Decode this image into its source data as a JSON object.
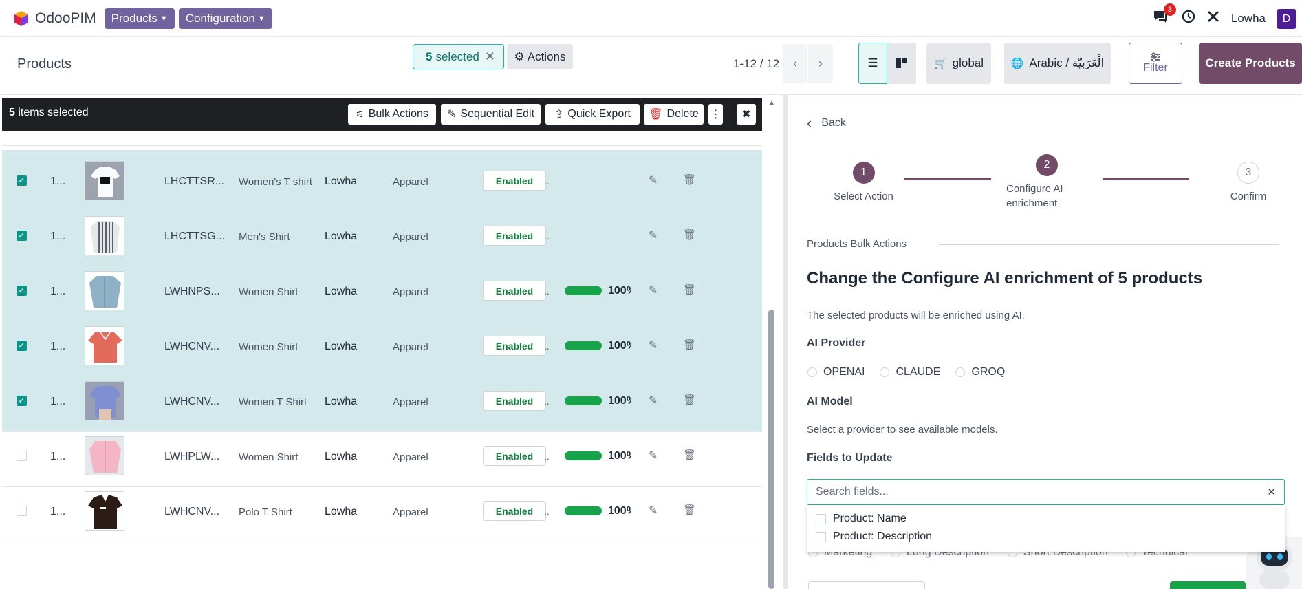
{
  "topbar": {
    "app_name": "OdooPIM",
    "menus": [
      {
        "label": "Products"
      },
      {
        "label": "Configuration"
      }
    ],
    "chat_badge": "3",
    "user_name": "Lowha",
    "avatar_letter": "D"
  },
  "control_panel": {
    "title": "Products",
    "selected_count": "5",
    "selected_label": "selected",
    "actions_label": "Actions",
    "pager": "1-12 / 12",
    "scope_label": "global",
    "language_label": "Arabic / الْعَرَبيّة",
    "filter_label": "Filter",
    "create_label": "Create Products"
  },
  "bulk_bar": {
    "count": "5",
    "count_suffix": "items selected",
    "bulk_actions": "Bulk Actions",
    "sequential_edit": "Sequential Edit",
    "quick_export": "Quick Export",
    "delete": "Delete"
  },
  "rows": [
    {
      "seq": "1...",
      "sku": "LHCTTSR...",
      "name": "Women's T shirt",
      "brand": "Lowha",
      "category": "Apparel",
      "status": "Enabled",
      "status_extra": "..",
      "completeness": null,
      "selected": true,
      "image": "tshirt-white"
    },
    {
      "seq": "1...",
      "sku": "LHCTTSG...",
      "name": "Men's Shirt",
      "brand": "Lowha",
      "category": "Apparel",
      "status": "Enabled",
      "status_extra": "..",
      "completeness": null,
      "selected": true,
      "image": "shirt-striped"
    },
    {
      "seq": "1...",
      "sku": "LWHNPS...",
      "name": "Women Shirt",
      "brand": "Lowha",
      "category": "Apparel",
      "status": "Enabled",
      "status_extra": "..",
      "completeness": "100%",
      "selected": true,
      "image": "shirt-blue"
    },
    {
      "seq": "1...",
      "sku": "LWHCNV...",
      "name": "Women Shirt",
      "brand": "Lowha",
      "category": "Apparel",
      "status": "Enabled",
      "status_extra": "..",
      "completeness": "100%",
      "selected": true,
      "image": "shirt-coral"
    },
    {
      "seq": "1...",
      "sku": "LWHCNV...",
      "name": "Women T Shirt",
      "brand": "Lowha",
      "category": "Apparel",
      "status": "Enabled",
      "status_extra": "..",
      "completeness": "100%",
      "selected": true,
      "image": "tshirt-blue"
    },
    {
      "seq": "1...",
      "sku": "LWHPLW...",
      "name": "Women Shirt",
      "brand": "Lowha",
      "category": "Apparel",
      "status": "Enabled",
      "status_extra": "..",
      "completeness": "100%",
      "selected": false,
      "image": "shirt-pink"
    },
    {
      "seq": "1...",
      "sku": "LWHCNV...",
      "name": "Polo T Shirt",
      "brand": "Lowha",
      "category": "Apparel",
      "status": "Enabled",
      "status_extra": "..",
      "completeness": "100%",
      "selected": false,
      "image": "polo-brown"
    }
  ],
  "wizard": {
    "back": "Back",
    "steps": [
      {
        "number": "1",
        "label": "Select Action"
      },
      {
        "number": "2",
        "label": "Configure AI enrichment"
      },
      {
        "number": "3",
        "label": "Confirm"
      }
    ],
    "section": "Products Bulk Actions",
    "heading": "Change the Configure AI enrichment of 5 products",
    "description": "The selected products will be enriched using AI.",
    "provider_label": "AI Provider",
    "providers": [
      "OPENAI",
      "CLAUDE",
      "GROQ"
    ],
    "model_label": "AI Model",
    "model_hint": "Select a provider to see available models.",
    "fields_label": "Fields to Update",
    "search_placeholder": "Search fields...",
    "field_options": [
      "Product: Name",
      "Product: Description"
    ],
    "behind_options": [
      "Marketing",
      "Long Description",
      "Short Description",
      "Technical"
    ]
  },
  "colors": {
    "brand": "#714b67",
    "menu": "#71639e",
    "accent": "#14b8a6",
    "selected_row": "#d3e9ec",
    "success": "#16a34a"
  },
  "icons": [
    "logo-cube-icon",
    "chat-icon",
    "clock-icon",
    "tools-icon",
    "gear-icon",
    "list-view-icon",
    "kanban-view-icon",
    "cart-icon",
    "globe-icon",
    "sliders-icon",
    "edit-icon",
    "trash-icon",
    "kebab-icon",
    "close-icon",
    "chevron-left-icon",
    "chevron-right-icon",
    "robot-icon"
  ]
}
